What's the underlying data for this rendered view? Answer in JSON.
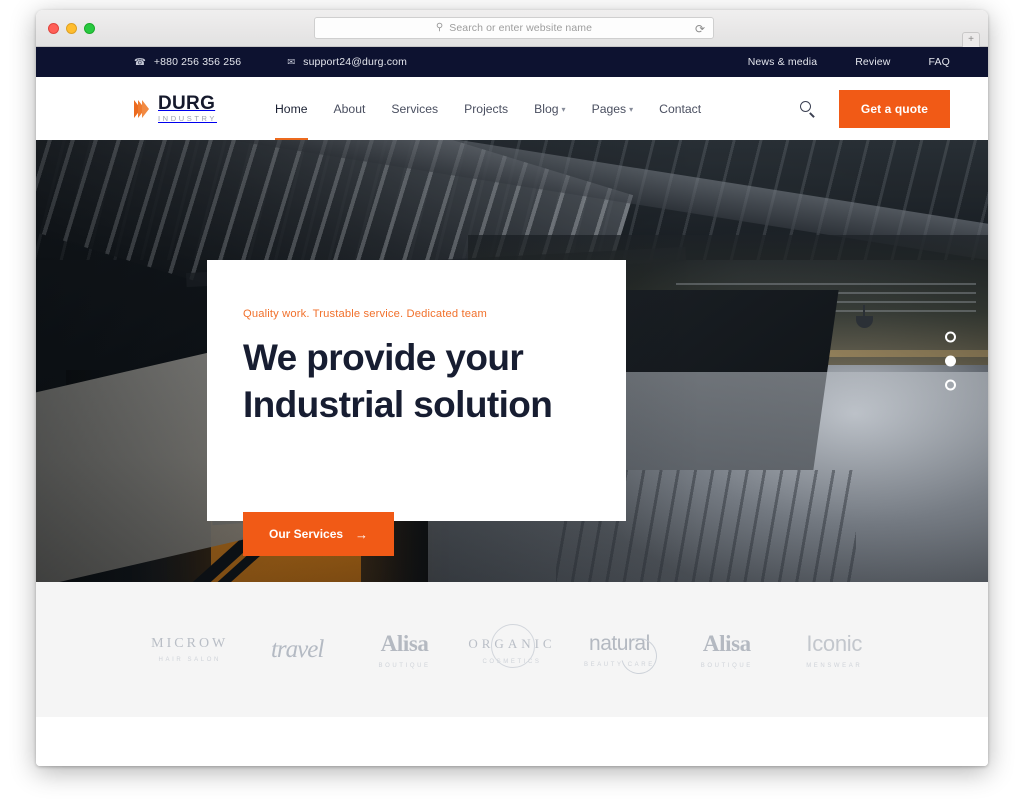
{
  "browser": {
    "url_placeholder": "Search or enter website name",
    "search_icon": "search-icon",
    "reload_icon": "reload-icon",
    "new_tab_label": "+",
    "traffic_lights": [
      "close",
      "minimize",
      "maximize"
    ]
  },
  "topbar": {
    "phone_icon": "phone-icon",
    "phone": "+880 256 356 256",
    "email_icon": "envelope-icon",
    "email": "support24@durg.com",
    "links": [
      {
        "label": "News & media"
      },
      {
        "label": "Review"
      },
      {
        "label": "FAQ"
      }
    ],
    "background_color": "#0d1230"
  },
  "header": {
    "logo": {
      "name": "DURG",
      "tagline": "INDUSTRY",
      "icon": "chevron-logo-icon",
      "color": "#ec6a1e"
    },
    "nav": [
      {
        "label": "Home",
        "active": true,
        "dropdown": false
      },
      {
        "label": "About",
        "active": false,
        "dropdown": false
      },
      {
        "label": "Services",
        "active": false,
        "dropdown": false
      },
      {
        "label": "Projects",
        "active": false,
        "dropdown": false
      },
      {
        "label": "Blog",
        "active": false,
        "dropdown": true
      },
      {
        "label": "Pages",
        "active": false,
        "dropdown": true
      },
      {
        "label": "Contact",
        "active": false,
        "dropdown": false
      }
    ],
    "search_icon": "search-icon",
    "quote_button": "Get a quote",
    "accent_color": "#f15a16"
  },
  "hero": {
    "eyebrow": "Quality work. Trustable service. Dedicated team",
    "title_line1": "We provide your",
    "title_line2": "Industrial solution",
    "cta_label": "Our Services",
    "cta_arrow": "→",
    "title_color": "#171d31",
    "eyebrow_color": "#f1712c",
    "slider_dots": [
      {
        "active": false
      },
      {
        "active": true
      },
      {
        "active": false
      }
    ],
    "background_description": "dark industrial factory interior with steel staircases and orange furnace glow"
  },
  "clients": {
    "background_color": "#f5f5f5",
    "logos": [
      {
        "name": "MICROW",
        "sub": "HAIR SALON",
        "style": "cl-microw"
      },
      {
        "name": "travel",
        "sub": "",
        "style": "cl-travel"
      },
      {
        "name": "Alisa",
        "sub": "BOUTIQUE",
        "style": "cl-alisa1"
      },
      {
        "name": "ORGANIC",
        "sub": "COSMETICS",
        "style": "cl-organic"
      },
      {
        "name": "natural",
        "sub": "BEAUTY CARE",
        "style": "cl-natural"
      },
      {
        "name": "Alisa",
        "sub": "BOUTIQUE",
        "style": "cl-alisa2"
      },
      {
        "name": "Iconic",
        "sub": "MENSWEAR",
        "style": "cl-iconic"
      }
    ]
  }
}
